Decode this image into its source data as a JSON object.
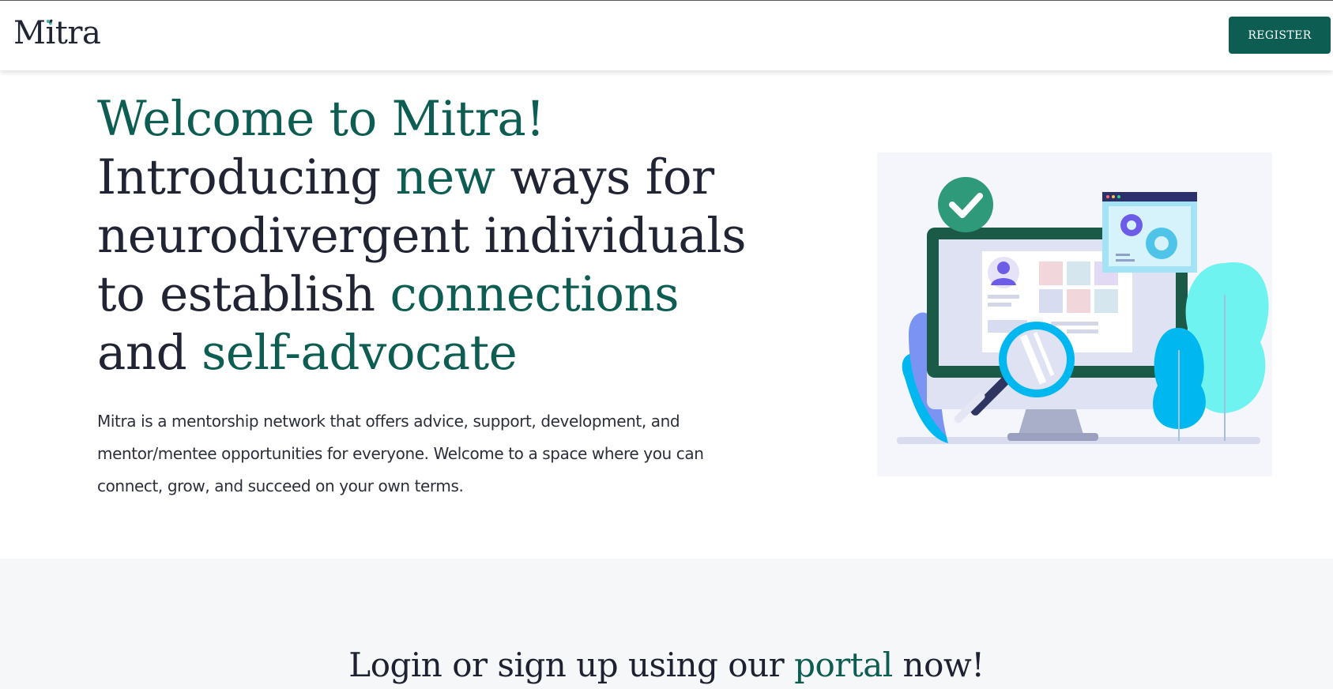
{
  "brand": {
    "name": "Mitra",
    "accent_color": "#0d5d52",
    "text_color": "#202433"
  },
  "nav": {
    "register_label": "REGISTER"
  },
  "hero": {
    "welcome": "Welcome to Mitra!",
    "line2_a": "Introducing ",
    "line2_accent": "new",
    "line2_b": " ways for",
    "line3": "neurodivergent individuals",
    "line4_a": "to establish ",
    "line4_accent": "connections",
    "line5_a": "and ",
    "line5_accent": "self-advocate",
    "intro": "Mitra is a mentorship network that offers advice, support, development, and mentor/mentee opportunities for everyone. Welcome to a space where you can connect, grow, and succeed on your own terms.",
    "illustration_icon": "monitor-magnifier-illustration"
  },
  "portal": {
    "heading_a": "Login or sign up using our ",
    "heading_accent": "portal",
    "heading_b": " now!"
  }
}
